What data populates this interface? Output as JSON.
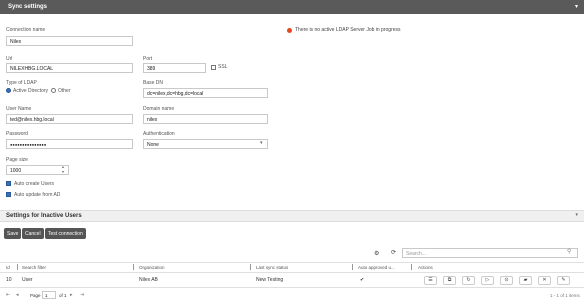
{
  "header": {
    "title": "Sync settings",
    "collapse_icon": "chevron-down-icon"
  },
  "form": {
    "connection_name": {
      "label": "Connection name",
      "value": "Nilex"
    },
    "url": {
      "label": "Url",
      "value": "NILEXHBG.LOCAL"
    },
    "port": {
      "label": "Port",
      "value": "389"
    },
    "ssl": {
      "label": "SSL",
      "checked": false
    },
    "type": {
      "label": "Type of LDAP",
      "options": [
        "Active Directory",
        "Other"
      ],
      "selected": "Active Directory"
    },
    "base_dn": {
      "label": "Base DN",
      "value": "dc=nilex,dc=hbg,dc=local"
    },
    "user_name": {
      "label": "User Name",
      "value": "ted@nilex.hbg.local"
    },
    "domain_name": {
      "label": "Domain name",
      "value": "nilex"
    },
    "password": {
      "label": "Password",
      "value": "●●●●●●●●●●●●●●●"
    },
    "authentication": {
      "label": "Authentication",
      "value": "None"
    },
    "page_size": {
      "label": "Page size",
      "value": "1000"
    },
    "auto_create": {
      "label": "Auto create Users",
      "checked": true
    },
    "auto_update": {
      "label": "Auto update from AD",
      "checked": true
    }
  },
  "status": {
    "text": "There is no active LDAP Server Job in progress",
    "color": "#e8461e"
  },
  "inactive_section": {
    "title": "Settings for Inactive Users"
  },
  "buttons": {
    "save": "Save",
    "cancel": "Cancel",
    "test": "Test connection"
  },
  "table": {
    "search_placeholder": "Search...",
    "headers": {
      "id": "Id",
      "search_filter": "Search filter",
      "organization": "Organization",
      "last_status": "Last sync status",
      "auto_approved": "Auto approved u...",
      "actions": "Actions"
    },
    "rows": [
      {
        "id": "10",
        "search_filter": "User",
        "organization": "Nilex AB",
        "last_status": "New Testing",
        "auto_approved": "✔"
      }
    ]
  },
  "pager": {
    "page_label": "Page",
    "page_value": "1",
    "of_label": "of 1",
    "summary": "1 - 1 of 1 items"
  },
  "accent": "#3a6fb7"
}
